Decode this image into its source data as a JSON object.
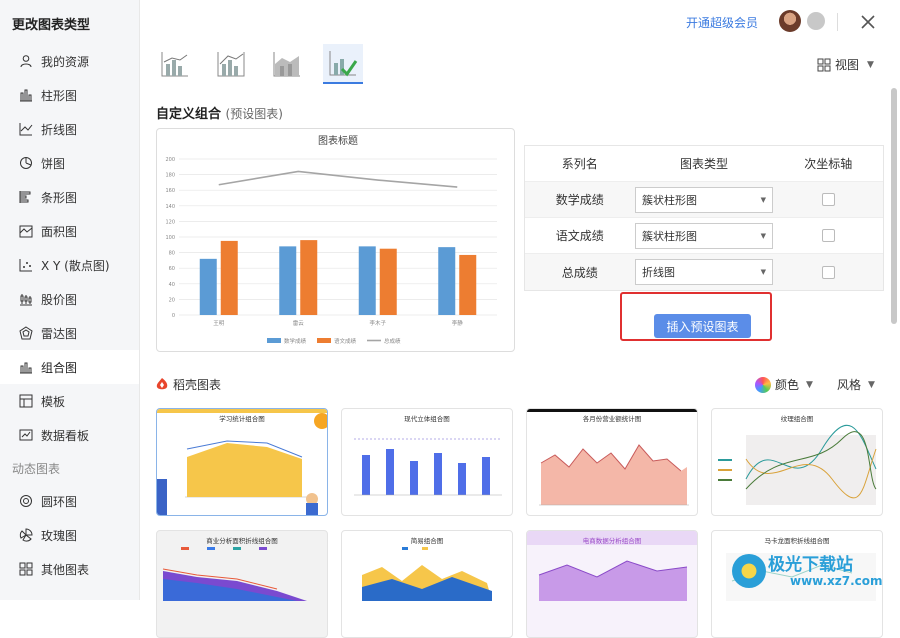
{
  "sidebar": {
    "title": "更改图表类型",
    "items": [
      {
        "label": "我的资源",
        "icon": "user-icon"
      },
      {
        "label": "柱形图",
        "icon": "column-chart-icon"
      },
      {
        "label": "折线图",
        "icon": "line-chart-icon"
      },
      {
        "label": "饼图",
        "icon": "pie-chart-icon"
      },
      {
        "label": "条形图",
        "icon": "bar-chart-icon"
      },
      {
        "label": "面积图",
        "icon": "area-chart-icon"
      },
      {
        "label": "X Y (散点图)",
        "icon": "scatter-chart-icon"
      },
      {
        "label": "股价图",
        "icon": "stock-chart-icon"
      },
      {
        "label": "雷达图",
        "icon": "radar-chart-icon"
      },
      {
        "label": "组合图",
        "icon": "combo-chart-icon",
        "active": true
      },
      {
        "label": "模板",
        "icon": "template-icon"
      },
      {
        "label": "数据看板",
        "icon": "dashboard-icon"
      }
    ],
    "group_label": "动态图表",
    "dynamic_items": [
      {
        "label": "圆环图",
        "icon": "donut-chart-icon"
      },
      {
        "label": "玫瑰图",
        "icon": "rose-chart-icon"
      },
      {
        "label": "其他图表",
        "icon": "other-chart-icon"
      }
    ]
  },
  "header": {
    "vip_link": "开通超级会员",
    "view_label": "视图"
  },
  "custom_combo": {
    "title": "自定义组合",
    "subtitle": "(预设图表)"
  },
  "series_table": {
    "headers": [
      "系列名",
      "图表类型",
      "次坐标轴"
    ],
    "rows": [
      {
        "name": "数学成绩",
        "type": "簇状柱形图",
        "secondary": false
      },
      {
        "name": "语文成绩",
        "type": "簇状柱形图",
        "secondary": false
      },
      {
        "name": "总成绩",
        "type": "折线图",
        "secondary": false
      }
    ]
  },
  "insert_button": "插入预设图表",
  "daoke": {
    "title": "稻壳图表",
    "color_label": "颜色",
    "style_label": "风格"
  },
  "cards": [
    {
      "title": "学习统计组合图"
    },
    {
      "title": "现代立体组合图"
    },
    {
      "title": "各月份营业额统计图"
    },
    {
      "title": "纹理组合图"
    },
    {
      "title": "商业分析面积折线组合图"
    },
    {
      "title": "简易组合图"
    },
    {
      "title": "电商数据分析组合图"
    },
    {
      "title": "马卡龙面积折线组合图"
    }
  ],
  "watermark": {
    "text": "极光下载站",
    "sub": "www.xz7.com"
  },
  "chart_data": {
    "type": "bar",
    "title": "图表标题",
    "categories": [
      "王明",
      "雷云",
      "李木子",
      "李静"
    ],
    "series": [
      {
        "name": "数学成绩",
        "type": "bar",
        "color": "#5b9bd5",
        "values": [
          72,
          88,
          88,
          87
        ]
      },
      {
        "name": "语文成绩",
        "type": "bar",
        "color": "#ed7d31",
        "values": [
          95,
          96,
          85,
          77
        ]
      },
      {
        "name": "总成绩",
        "type": "line",
        "color": "#a5a5a5",
        "values": [
          167,
          184,
          173,
          164
        ]
      }
    ],
    "ylim": [
      0,
      200
    ],
    "yticks": [
      0,
      20,
      40,
      60,
      80,
      100,
      120,
      140,
      160,
      180,
      200
    ],
    "grid": true,
    "legend": "bottom"
  },
  "colors": {
    "accent": "#3b7be0",
    "highlight": "#e03030"
  }
}
